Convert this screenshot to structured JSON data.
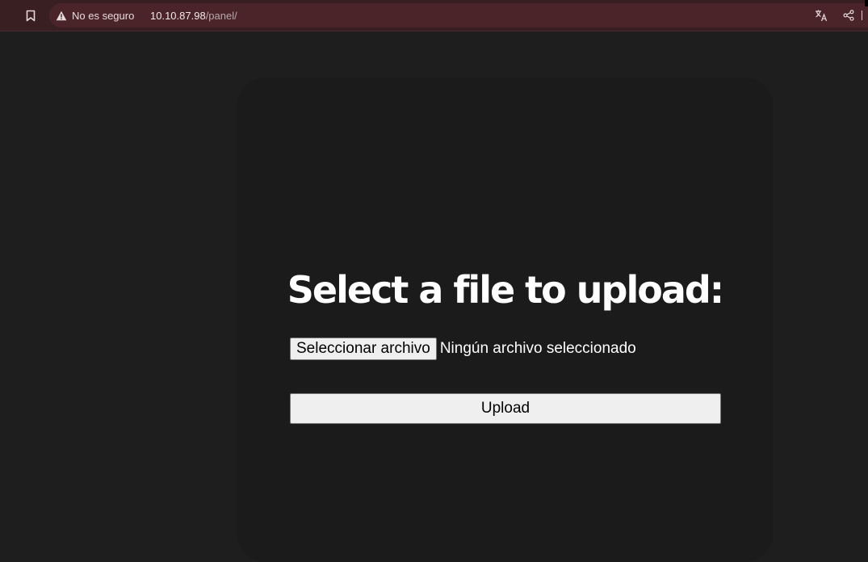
{
  "browser": {
    "security_label": "No es seguro",
    "url_host": "10.10.87.98",
    "url_path": "/panel/",
    "icons": {
      "bookmark": "bookmark-icon",
      "warning": "warning-icon",
      "translate": "translate-icon",
      "share": "share-icon"
    }
  },
  "upload_form": {
    "title": "Select a file to upload:",
    "choose_file_label": "Seleccionar archivo",
    "no_file_text": "Ningún archivo seleccionado",
    "submit_label": "Upload"
  },
  "colors": {
    "browser_bar": "#3a1f22",
    "omnibox": "#4a2428",
    "page_background": "#1e1e1e",
    "card_background": "#1b1b1b",
    "title_text": "#ffffff",
    "button_background": "#efefef"
  }
}
